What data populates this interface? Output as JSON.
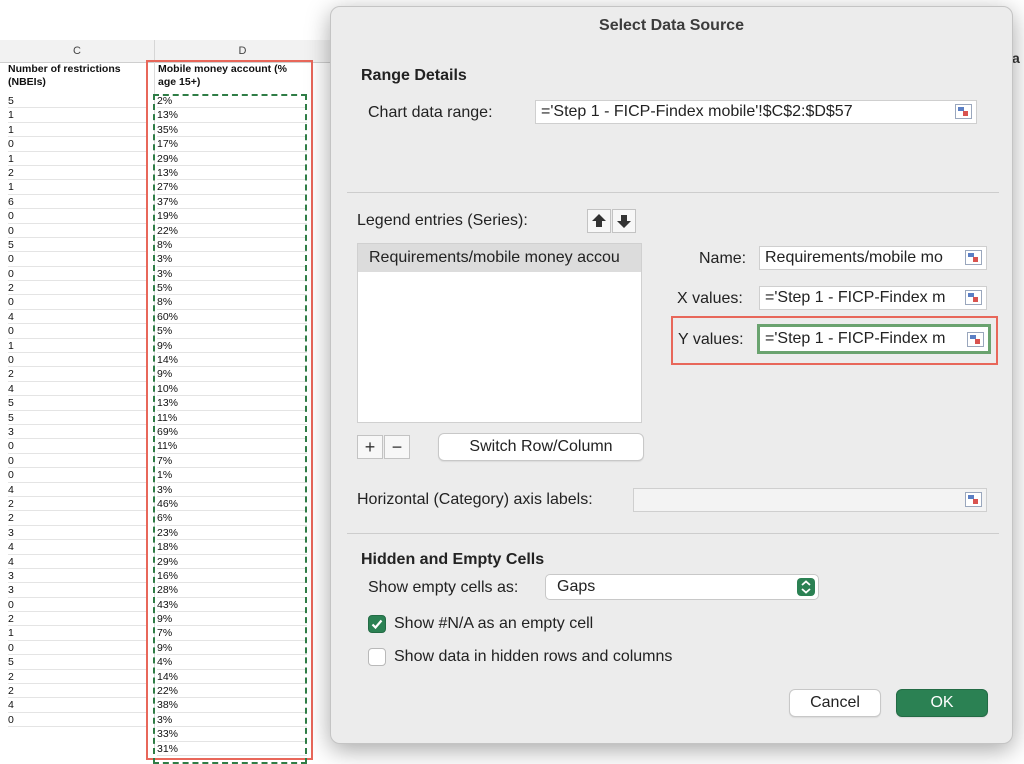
{
  "sheet": {
    "col_c_letter": "C",
    "col_d_letter": "D",
    "col_c_header": "Number of restrictions (NBEIs)",
    "col_d_header": "Mobile money account (% age 15+)",
    "col_c_values": [
      "5",
      "1",
      "1",
      "0",
      "1",
      "2",
      "1",
      "6",
      "0",
      "0",
      "5",
      "0",
      "0",
      "2",
      "0",
      "4",
      "0",
      "1",
      "0",
      "2",
      "4",
      "5",
      "5",
      "3",
      "0",
      "0",
      "0",
      "4",
      "2",
      "2",
      "3",
      "4",
      "4",
      "3",
      "3",
      "0",
      "2",
      "1",
      "0",
      "5",
      "2",
      "2",
      "4",
      "0"
    ],
    "col_d_values": [
      "2%",
      "13%",
      "35%",
      "17%",
      "29%",
      "13%",
      "27%",
      "37%",
      "19%",
      "22%",
      "8%",
      "3%",
      "3%",
      "5%",
      "8%",
      "60%",
      "5%",
      "9%",
      "14%",
      "9%",
      "10%",
      "13%",
      "11%",
      "69%",
      "11%",
      "7%",
      "1%",
      "3%",
      "46%",
      "6%",
      "23%",
      "18%",
      "29%",
      "16%",
      "28%",
      "43%",
      "9%",
      "7%",
      "9%",
      "4%",
      "14%",
      "22%",
      "38%",
      "3%",
      "33%",
      "31%"
    ],
    "right_edge_glyph": "a"
  },
  "dialog": {
    "title": "Select Data Source",
    "range_section": "Range Details",
    "chart_range_label": "Chart data range:",
    "chart_range_value": "='Step 1 - FICP-Findex mobile'!$C$2:$D$57",
    "legend_label": "Legend entries (Series):",
    "series": [
      "Requirements/mobile money accou"
    ],
    "name_label": "Name:",
    "name_value": "Requirements/mobile mo",
    "x_label": "X values:",
    "x_value": "='Step 1 - FICP-Findex m",
    "y_label": "Y values:",
    "y_value": "='Step 1 - FICP-Findex m",
    "add_label": "+",
    "remove_label": "−",
    "switch_label": "Switch Row/Column",
    "category_label": "Horizontal (Category) axis labels:",
    "category_value": "",
    "hidden_section": "Hidden and Empty Cells",
    "empty_cells_label": "Show empty cells as:",
    "empty_cells_value": "Gaps",
    "na_label": "Show #N/A as an empty cell",
    "na_checked": true,
    "hidden_rows_label": "Show data in hidden rows and columns",
    "hidden_rows_checked": false,
    "cancel_label": "Cancel",
    "ok_label": "OK"
  },
  "colors": {
    "accent_green": "#2b8153",
    "highlight_red": "#e8675a",
    "marquee_green": "#2f7d46"
  }
}
